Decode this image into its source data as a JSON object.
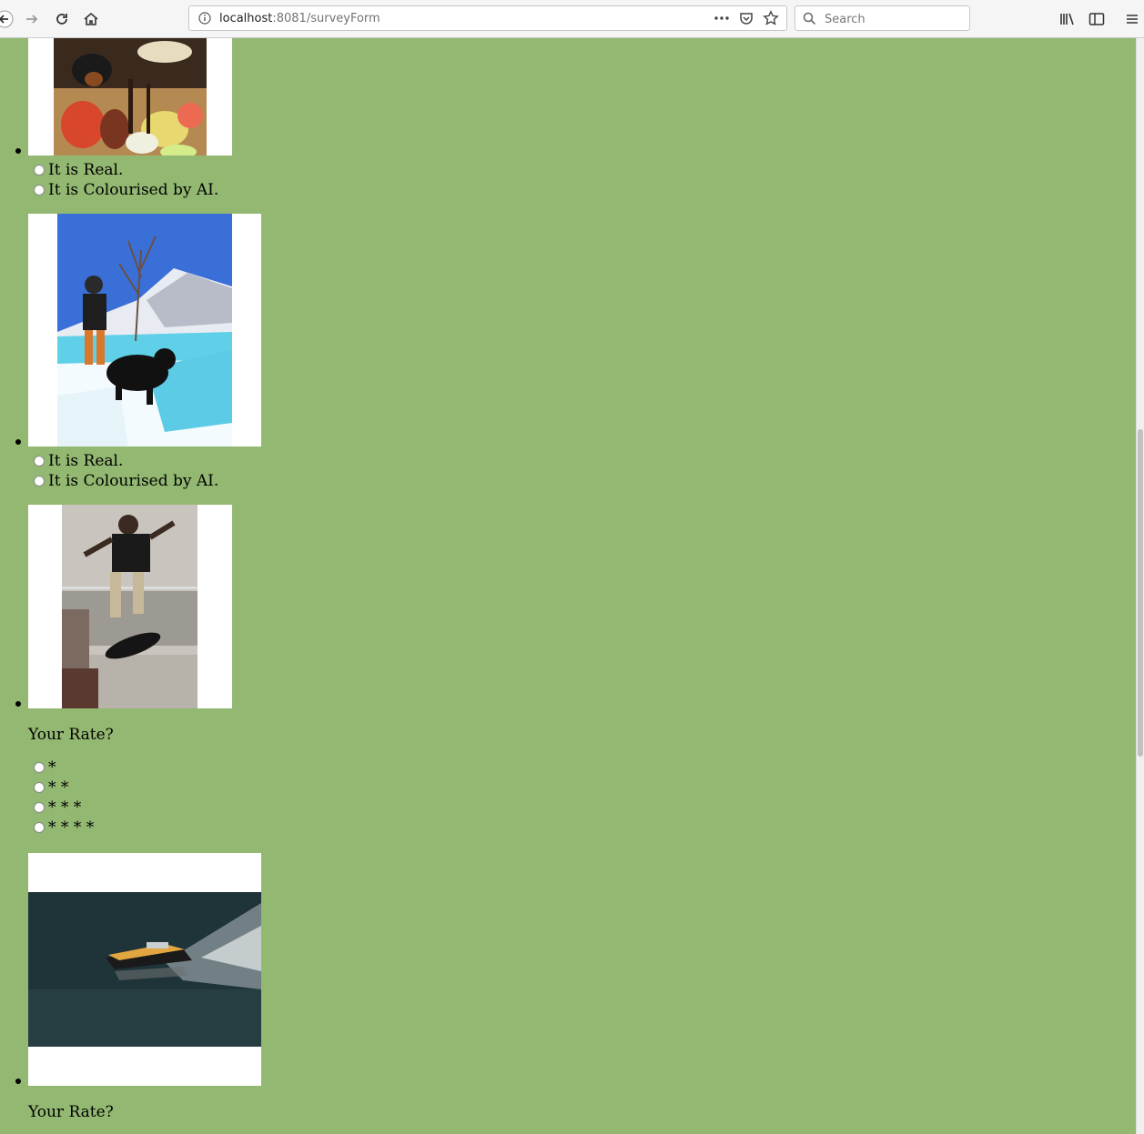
{
  "browser": {
    "url_host": "localhost",
    "url_port": ":8081",
    "url_path": "/surveyForm",
    "search_placeholder": "Search"
  },
  "survey": {
    "items": [
      {
        "photo_icon": "food-photo",
        "options": [
          "It is Real.",
          "It is Colourised by AI."
        ]
      },
      {
        "photo_icon": "snow-hiker-dog-photo",
        "options": [
          "It is Real.",
          "It is Colourised by AI."
        ]
      },
      {
        "photo_icon": "skateboarder-photo",
        "rate_label": "Your Rate?",
        "rate_options": [
          "*",
          "* *",
          "* * *",
          "* * * *"
        ]
      },
      {
        "photo_icon": "speedboat-photo",
        "rate_label": "Your Rate?"
      }
    ]
  }
}
